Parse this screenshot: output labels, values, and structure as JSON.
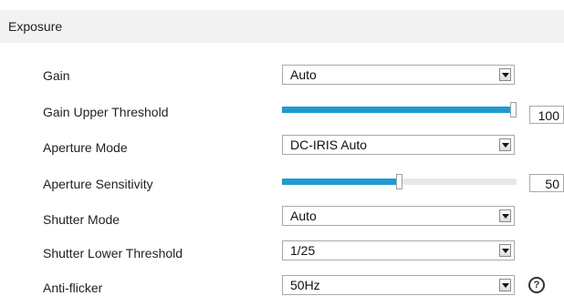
{
  "section": {
    "title": "Exposure"
  },
  "rows": {
    "gain": {
      "label": "Gain",
      "value": "Auto"
    },
    "gain_upper_threshold": {
      "label": "Gain Upper Threshold",
      "value": "100",
      "level_percent": 100
    },
    "aperture_mode": {
      "label": "Aperture Mode",
      "value": "DC-IRIS Auto"
    },
    "aperture_sensitivity": {
      "label": "Aperture Sensitivity",
      "value": "50",
      "level_percent": 50
    },
    "shutter_mode": {
      "label": "Shutter Mode",
      "value": "Auto"
    },
    "shutter_lower_threshold": {
      "label": "Shutter Lower Threshold",
      "value": "1/25"
    },
    "anti_flicker": {
      "label": "Anti-flicker",
      "value": "50Hz"
    }
  },
  "colors": {
    "accent": "#1f9ad1",
    "header_bg": "#f2f2f2"
  },
  "icons": {
    "help": "question-circle-icon",
    "dropdown": "chevron-down-icon"
  }
}
